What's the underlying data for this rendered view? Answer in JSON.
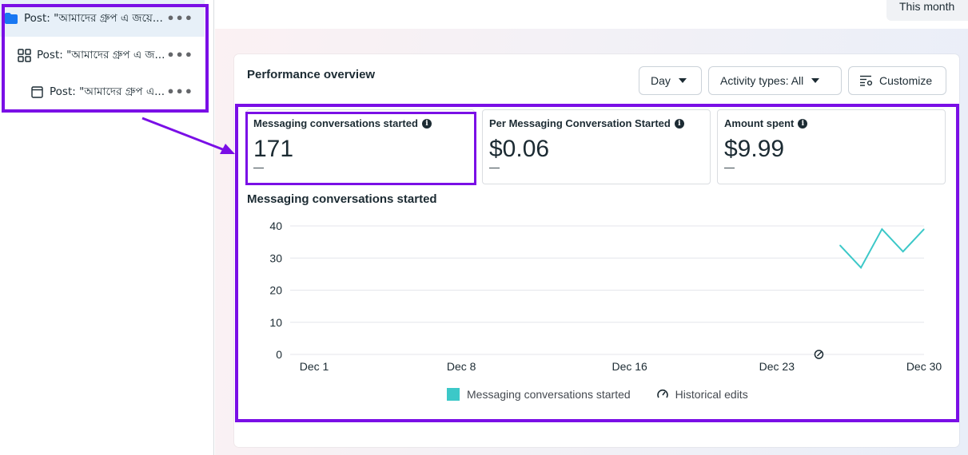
{
  "sidebar": {
    "items": [
      {
        "label": "Post: \"আমাদের গ্রুপ এ জয়ে...",
        "icon": "folder-icon",
        "selected": true
      },
      {
        "label": "Post: \"আমাদের গ্রুপ এ জ...",
        "icon": "grid-icon",
        "selected": false
      },
      {
        "label": "Post: \"আমাদের গ্রুপ এ...",
        "icon": "ad-icon",
        "selected": false
      }
    ],
    "more_label": "•••"
  },
  "header": {
    "date_range": "This month"
  },
  "performance": {
    "title": "Performance overview",
    "controls": {
      "day": "Day",
      "activity": "Activity types: All",
      "customize": "Customize"
    },
    "metrics": [
      {
        "label": "Messaging conversations started",
        "value": "171",
        "sub": "—"
      },
      {
        "label": "Per Messaging Conversation Started",
        "value": "$0.06",
        "sub": "—"
      },
      {
        "label": "Amount spent",
        "value": "$9.99",
        "sub": "—"
      }
    ],
    "chart_title": "Messaging conversations started"
  },
  "chart_data": {
    "type": "line",
    "title": "Messaging conversations started",
    "x_ticks": [
      "Dec 1",
      "Dec 8",
      "Dec 16",
      "Dec 23",
      "Dec 30"
    ],
    "x_tick_days": [
      1,
      8,
      16,
      23,
      30
    ],
    "ylim": [
      0,
      40
    ],
    "y_ticks": [
      0,
      10,
      20,
      30,
      40
    ],
    "grid": true,
    "series": [
      {
        "name": "Messaging conversations started",
        "color": "#3cc8c8",
        "x": [
          26,
          27,
          28,
          29,
          30
        ],
        "values": [
          34,
          27,
          39,
          32,
          39
        ]
      }
    ],
    "historical_edit_day": 25,
    "legend": [
      "Messaging conversations started",
      "Historical edits"
    ],
    "legend_position": "bottom"
  },
  "colors": {
    "annotation": "#7a0fe6",
    "series": "#3cc8c8",
    "folder": "#1877f2"
  }
}
